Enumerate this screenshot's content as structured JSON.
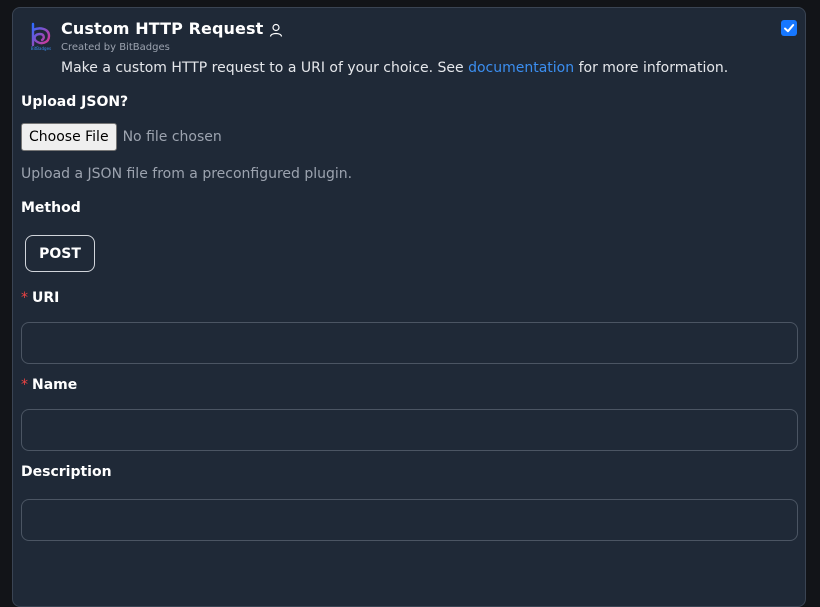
{
  "header": {
    "title": "Custom HTTP Request",
    "created_by": "Created by BitBadges",
    "description_pre": "Make a custom HTTP request to a URI of your choice. See ",
    "description_link": "documentation",
    "description_post": " for more information.",
    "enabled_checked": true,
    "logo_text": "BitBadges"
  },
  "upload": {
    "label": "Upload JSON?",
    "choose_button": "Choose File",
    "no_file": "No file chosen",
    "hint": "Upload a JSON file from a preconfigured plugin."
  },
  "method": {
    "label": "Method",
    "value": "POST"
  },
  "uri": {
    "label": "URI",
    "required_mark": "*",
    "value": ""
  },
  "name": {
    "label": "Name",
    "required_mark": "*",
    "value": ""
  },
  "description": {
    "label": "Description",
    "value": ""
  },
  "colors": {
    "accent": "#1677ff",
    "link": "#3b8ef0",
    "required": "#ef4444",
    "card_bg": "#1f2937"
  }
}
